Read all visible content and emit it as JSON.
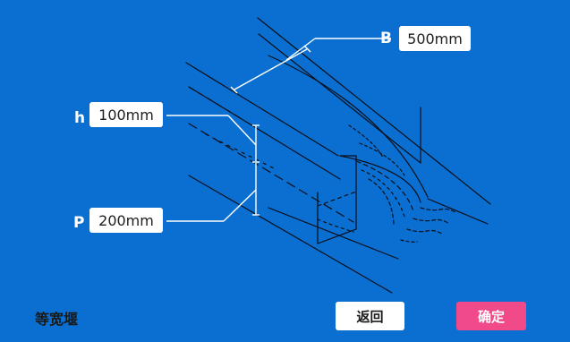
{
  "title": "等宽堰",
  "params": {
    "B": {
      "label": "B",
      "value": "500mm"
    },
    "h": {
      "label": "h",
      "value": "100mm"
    },
    "P": {
      "label": "P",
      "value": "200mm"
    }
  },
  "buttons": {
    "back": "返回",
    "confirm": "确定"
  },
  "colors": {
    "background": "#0a6fd0",
    "line": "#0b0f1a",
    "confirm_button": "#f04a8a",
    "back_button": "#ffffff"
  }
}
